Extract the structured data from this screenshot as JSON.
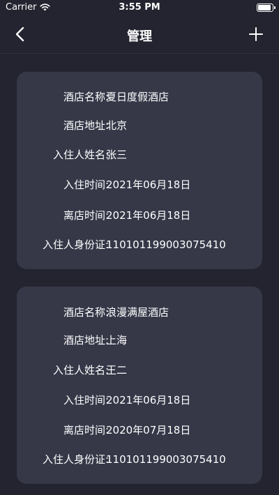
{
  "status_bar": {
    "carrier": "Carrier",
    "time": "3:55 PM"
  },
  "nav": {
    "title": "管理",
    "back_icon": "chevron-left-icon",
    "add_icon": "plus-icon"
  },
  "bookings": [
    {
      "fields": [
        {
          "label": "酒店名称:",
          "value": "夏日度假酒店"
        },
        {
          "label": "酒店地址:",
          "value": "北京"
        },
        {
          "label": "入住人姓名:",
          "value": "张三"
        },
        {
          "label": "入住时间:",
          "value": "2021年06月18日"
        },
        {
          "label": "离店时间:",
          "value": "2021年06月18日"
        },
        {
          "label": "入住人身份证:",
          "value": "110101199003075410"
        }
      ]
    },
    {
      "fields": [
        {
          "label": "酒店名称:",
          "value": "浪漫满屋酒店"
        },
        {
          "label": "酒店地址:",
          "value": "上海"
        },
        {
          "label": "入住人姓名:",
          "value": "王二"
        },
        {
          "label": "入住时间:",
          "value": "2021年06月18日"
        },
        {
          "label": "离店时间:",
          "value": "2020年07月18日"
        },
        {
          "label": "入住人身份证:",
          "value": "110101199003075410"
        }
      ]
    }
  ],
  "colors": {
    "background": "#23242f",
    "card": "#363848",
    "text": "#ffffff"
  }
}
